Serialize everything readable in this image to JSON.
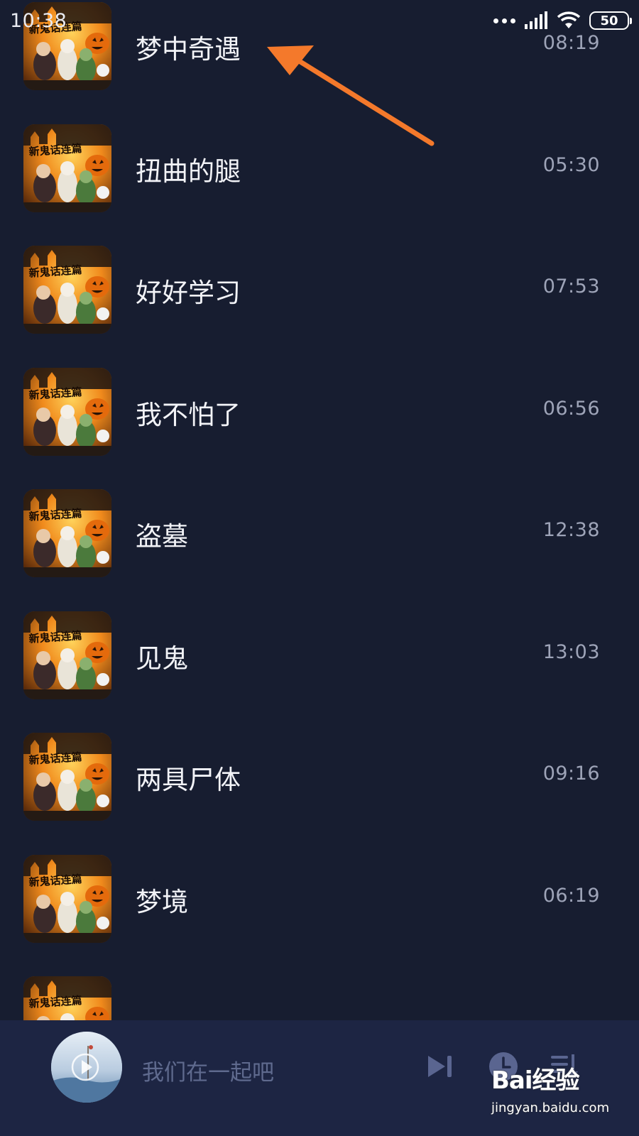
{
  "status_bar": {
    "time": "10:38",
    "battery": "50",
    "icons": [
      "more-dots-icon",
      "signal-icon",
      "wifi-icon",
      "battery-icon"
    ]
  },
  "tracks": [
    {
      "title": "梦中奇遇",
      "duration": "08:19"
    },
    {
      "title": "扭曲的腿",
      "duration": "05:30"
    },
    {
      "title": "好好学习",
      "duration": "07:53"
    },
    {
      "title": "我不怕了",
      "duration": "06:56"
    },
    {
      "title": "盗墓",
      "duration": "12:38"
    },
    {
      "title": "见鬼",
      "duration": "13:03"
    },
    {
      "title": "两具尸体",
      "duration": "09:16"
    },
    {
      "title": "梦境",
      "duration": "06:19"
    },
    {
      "title": "",
      "duration": ""
    }
  ],
  "cover_art_text": "新鬼话连篇",
  "player": {
    "now_playing": "我们在一起吧",
    "controls": [
      "next-icon",
      "timer-icon",
      "playlist-icon"
    ]
  },
  "watermark": {
    "logo": "Bai经验",
    "url": "jingyan.baidu.com"
  },
  "colors": {
    "background": "#171d30",
    "player_bar": "#1d2543",
    "annotation_arrow": "#f4792b",
    "control_icons": "#5a6590"
  }
}
